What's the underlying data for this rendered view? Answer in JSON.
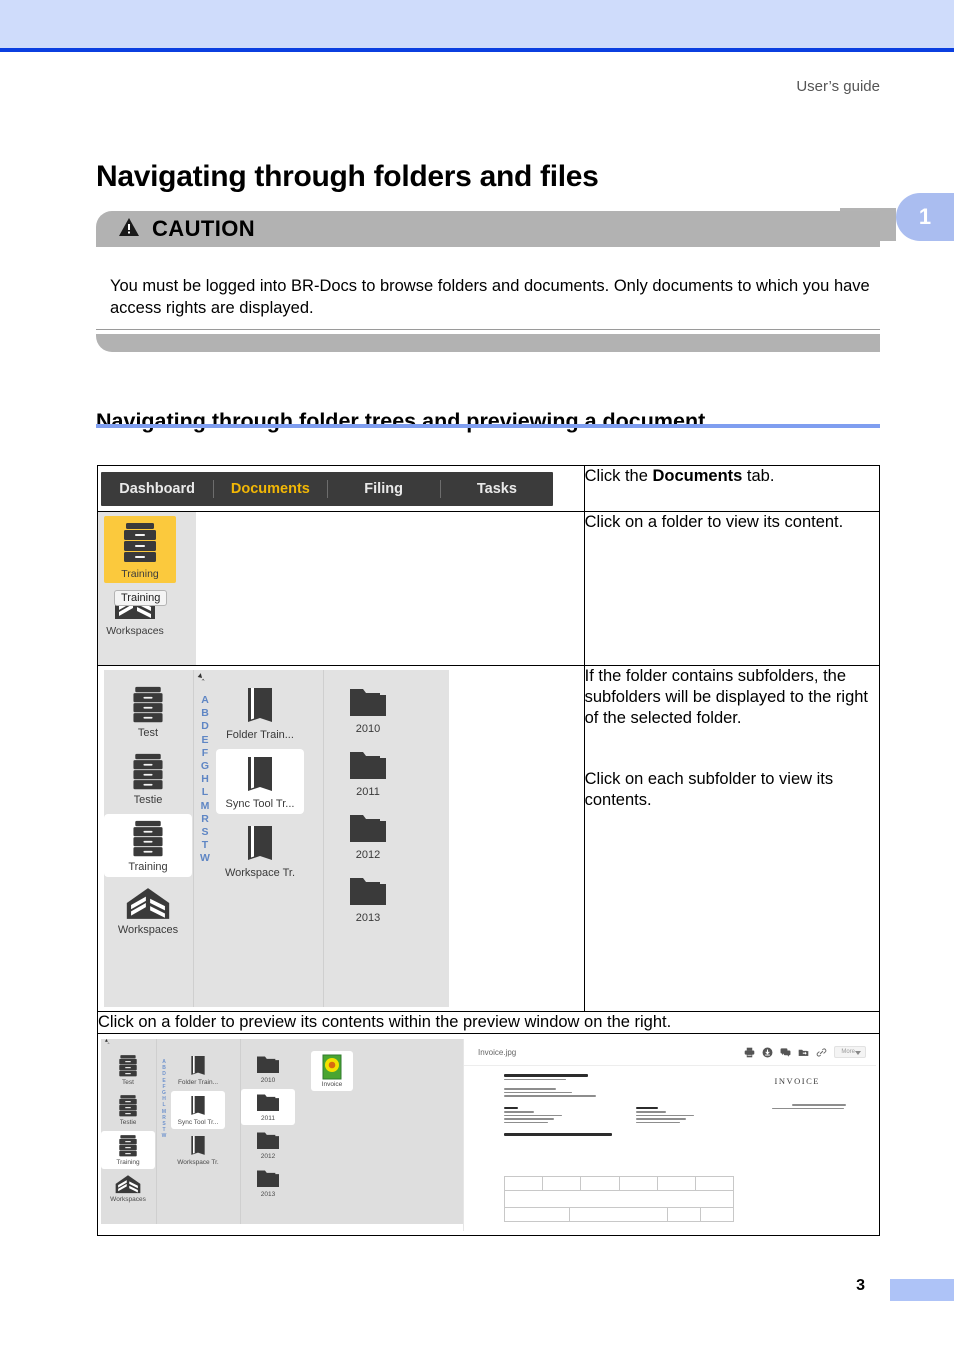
{
  "header": {
    "running_title": "User’s guide",
    "chapter_tab": "1"
  },
  "page_title": "Navigating through folders and files",
  "caution": {
    "label": "CAUTION",
    "icon": "warning-triangle-icon",
    "body": "You must be logged into BR-Docs to browse folders and documents. Only documents to which you have access rights are displayed."
  },
  "section": {
    "heading": "Navigating through folder trees and previewing a document"
  },
  "steps": [
    {
      "instruction_parts": [
        "Click the ",
        "Documents",
        " tab."
      ],
      "instruction_plain": "Click the Documents tab."
    },
    {
      "instruction_plain": "Click on a folder to view its content."
    },
    {
      "instruction_line1": "If the folder contains subfolders, the subfolders  will be displayed to the right of the selected folder.",
      "instruction_line2": "Click on each subfolder to view its contents."
    },
    {
      "instruction_plain": "Click on a folder to preview its contents within the preview window on the right."
    }
  ],
  "app": {
    "tabs": [
      {
        "label": "Dashboard",
        "active": false
      },
      {
        "label": "Documents",
        "active": true
      },
      {
        "label": "Filing",
        "active": false
      },
      {
        "label": "Tasks",
        "active": false
      }
    ],
    "tabbar_bg": "#3b3b3b",
    "tab_active_color": "#f2b705",
    "highlight_color": "#fbc93d",
    "panel_bg": "#e2e2e2",
    "step2": {
      "cabinet_label": "Training",
      "tooltip": "Training",
      "workspaces_label": "Workspaces"
    },
    "browser": {
      "cabinets": [
        "Test",
        "Testie",
        "Training"
      ],
      "selected_cabinet": "Training",
      "workspaces_label": "Workspaces",
      "alphabet": [
        "A",
        "B",
        "D",
        "E",
        "F",
        "G",
        "H",
        "L",
        "M",
        "R",
        "S",
        "T",
        "W"
      ],
      "books": [
        "Folder Train...",
        "Sync Tool Tr...",
        "Workspace Tr."
      ],
      "selected_book": "Sync Tool Tr...",
      "folders": [
        "2010",
        "2011",
        "2012",
        "2013"
      ]
    },
    "preview": {
      "selected_folder": "2011",
      "file_thumb_label": "Invoice",
      "filename": "Invoice.jpg",
      "toolbar_icons": [
        "print-icon",
        "download-icon",
        "comment-icon",
        "move-to-folder-icon",
        "link-icon"
      ],
      "more_label": "More",
      "document_title": "INVOICE"
    }
  },
  "footer": {
    "page_number": "3"
  }
}
